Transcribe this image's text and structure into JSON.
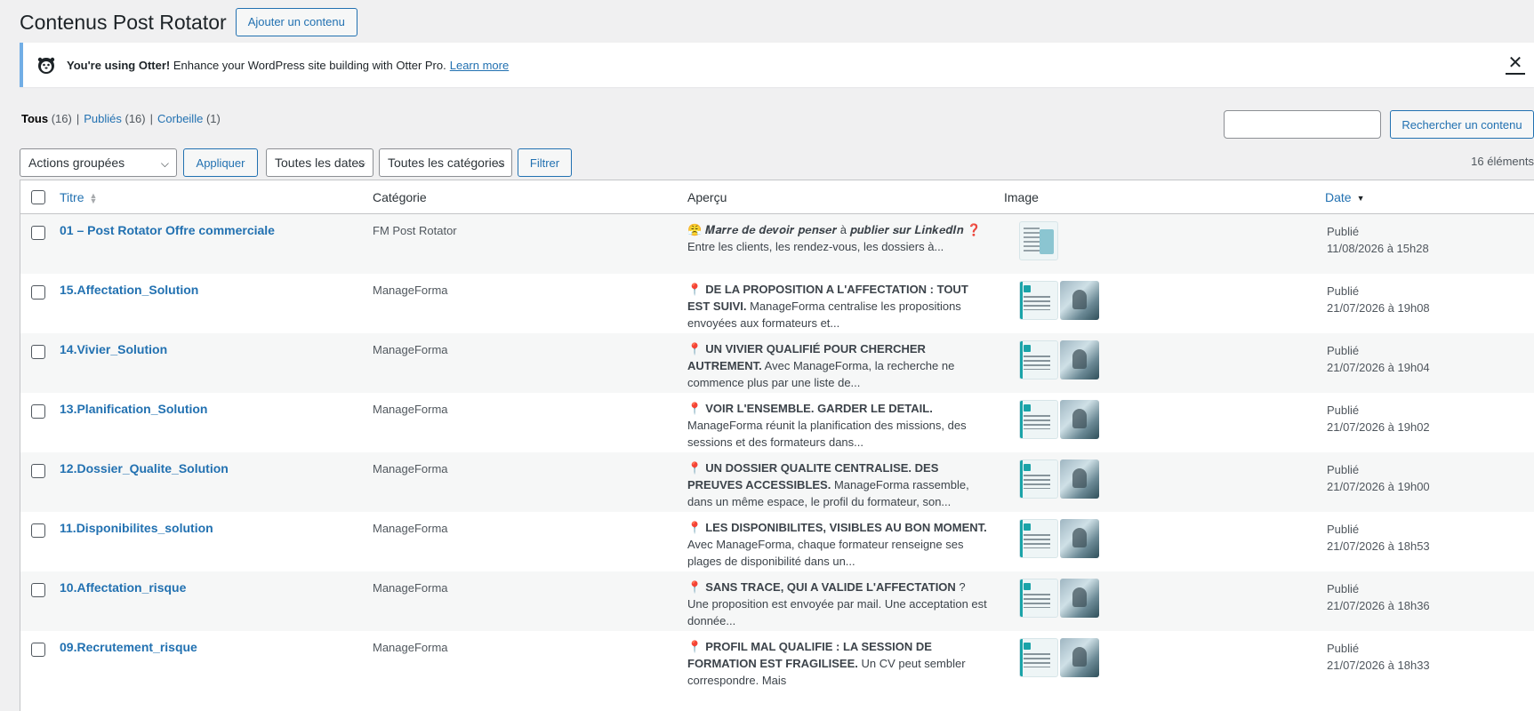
{
  "header": {
    "title": "Contenus Post Rotator",
    "add_label": "Ajouter un contenu"
  },
  "notice": {
    "strong": "You're using Otter!",
    "text": "Enhance your WordPress site building with Otter Pro.",
    "link": "Learn more",
    "close": "✕"
  },
  "views": [
    {
      "label": "Tous",
      "count": "(16)"
    },
    {
      "label": "Publiés",
      "count": "(16)"
    },
    {
      "label": "Corbeille",
      "count": "(1)"
    }
  ],
  "search": {
    "placeholder": "",
    "button": "Rechercher un contenu"
  },
  "tablenav": {
    "bulk_actions": "Actions groupées",
    "apply": "Appliquer",
    "dates": "Toutes les dates",
    "categories": "Toutes les catégories",
    "filter": "Filtrer",
    "items_count": "16 éléments"
  },
  "columns": {
    "title": "Titre",
    "category": "Catégorie",
    "preview": "Aperçu",
    "image": "Image",
    "date": "Date"
  },
  "rows": [
    {
      "title": "01 – Post Rotator Offre commerciale",
      "category": "FM Post Rotator",
      "preview_lead": "😤 𝑴𝒂𝒓𝒓𝒆 𝒅𝒆 𝒅𝒆𝒗𝒐𝒊𝒓 𝒑𝒆𝒏𝒔𝒆𝒓 à 𝒑𝒖𝒃𝒍𝒊𝒆𝒓 𝒔𝒖𝒓 𝑳𝒊𝒏𝒌𝒆𝒅𝑰𝒏 ❓",
      "preview_bold": "",
      "preview_rest": "Entre les clients, les rendez-vous, les dossiers à...",
      "status": "Publié",
      "date": "11/08/2026 à 15h28"
    },
    {
      "title": "15.Affectation_Solution",
      "category": "ManageForma",
      "preview_lead": "📍",
      "preview_bold": "DE LA PROPOSITION A L'AFFECTATION : TOUT EST SUIVI.",
      "preview_rest": " ManageForma centralise les propositions envoyées aux formateurs et...",
      "status": "Publié",
      "date": "21/07/2026 à 19h08"
    },
    {
      "title": "14.Vivier_Solution",
      "category": "ManageForma",
      "preview_lead": "📍",
      "preview_bold": "UN VIVIER QUALIFIÉ POUR CHERCHER AUTREMENT.",
      "preview_rest": " Avec ManageForma, la recherche ne commence plus par une liste de...",
      "status": "Publié",
      "date": "21/07/2026 à 19h04"
    },
    {
      "title": "13.Planification_Solution",
      "category": "ManageForma",
      "preview_lead": "📍",
      "preview_bold": "VOIR L'ENSEMBLE. GARDER LE DETAIL.",
      "preview_rest": " ManageForma réunit la planification des missions, des sessions et des formateurs dans...",
      "status": "Publié",
      "date": "21/07/2026 à 19h02"
    },
    {
      "title": "12.Dossier_Qualite_Solution",
      "category": "ManageForma",
      "preview_lead": "📍",
      "preview_bold": "UN DOSSIER QUALITE CENTRALISE. DES PREUVES ACCESSIBLES.",
      "preview_rest": " ManageForma rassemble, dans un même espace, le profil du formateur, son...",
      "status": "Publié",
      "date": "21/07/2026 à 19h00"
    },
    {
      "title": "11.Disponibilites_solution",
      "category": "ManageForma",
      "preview_lead": "📍",
      "preview_bold": "LES DISPONIBILITES, VISIBLES AU BON MOMENT.",
      "preview_rest": " Avec ManageForma, chaque formateur renseigne ses plages de disponibilité dans un...",
      "status": "Publié",
      "date": "21/07/2026 à 18h53"
    },
    {
      "title": "10.Affectation_risque",
      "category": "ManageForma",
      "preview_lead": "📍",
      "preview_bold": "SANS TRACE, QUI A VALIDE L'AFFECTATION",
      "preview_rest": " ? Une proposition est envoyée par mail. Une acceptation est donnée...",
      "status": "Publié",
      "date": "21/07/2026 à 18h36"
    },
    {
      "title": "09.Recrutement_risque",
      "category": "ManageForma",
      "preview_lead": "📍",
      "preview_bold": "PROFIL MAL QUALIFIE : LA SESSION DE FORMATION EST FRAGILISEE.",
      "preview_rest": " Un CV peut sembler correspondre. Mais",
      "status": "Publié",
      "date": "21/07/2026 à 18h33"
    }
  ]
}
